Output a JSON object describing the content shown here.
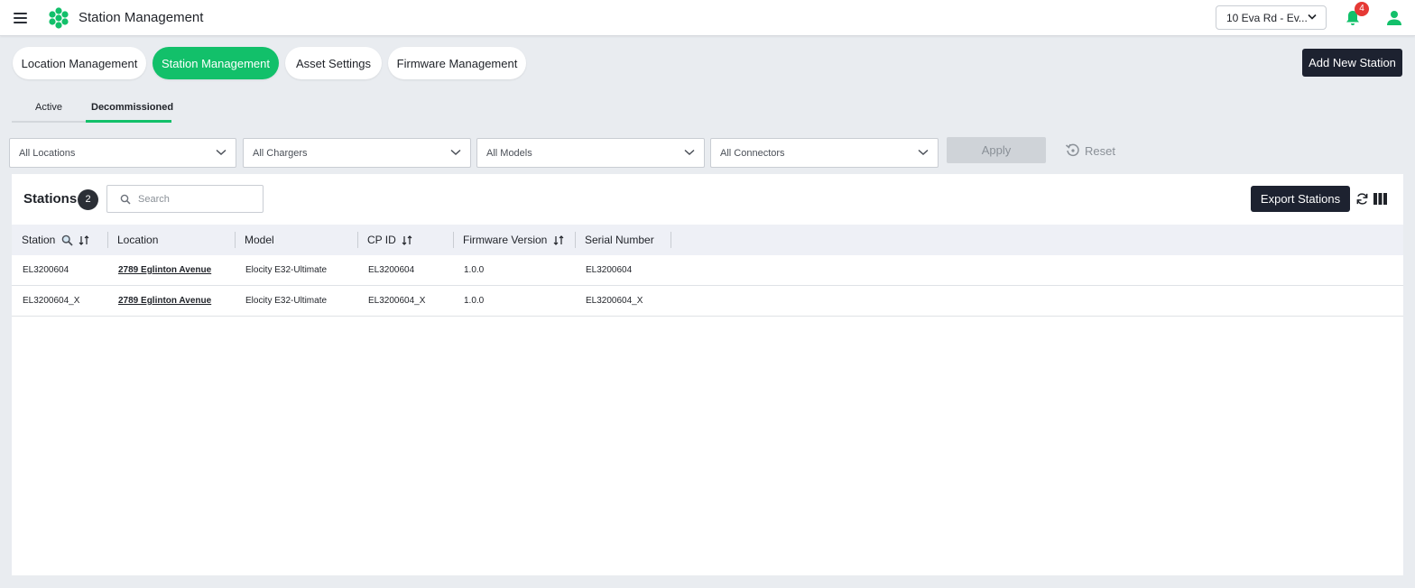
{
  "header": {
    "title": "Station Management",
    "site_selector": "10 Eva Rd - Ev...",
    "notification_count": "4"
  },
  "tabs": [
    {
      "label": "Location Management",
      "active": false
    },
    {
      "label": "Station Management",
      "active": true
    },
    {
      "label": "Asset Settings",
      "active": false
    },
    {
      "label": "Firmware Management",
      "active": false
    }
  ],
  "add_button": "Add New Station",
  "subtabs": [
    {
      "label": "Active",
      "active": false
    },
    {
      "label": "Decommissioned",
      "active": true
    }
  ],
  "filters": {
    "locations": "All Locations",
    "chargers": "All Chargers",
    "models": "All Models",
    "connectors": "All Connectors",
    "apply": "Apply",
    "reset": "Reset"
  },
  "panel": {
    "title": "Stations",
    "count": "2",
    "search_placeholder": "Search",
    "export": "Export Stations"
  },
  "table": {
    "columns": [
      "Station",
      "Location",
      "Model",
      "CP ID",
      "Firmware Version",
      "Serial Number"
    ],
    "rows": [
      {
        "station": "EL3200604",
        "location": "2789 Eglinton Avenue",
        "model": "Elocity E32-Ultimate",
        "cp_id": "EL3200604",
        "firmware": "1.0.0",
        "serial": "EL3200604"
      },
      {
        "station": "EL3200604_X",
        "location": "2789 Eglinton Avenue",
        "model": "Elocity E32-Ultimate",
        "cp_id": "EL3200604_X",
        "firmware": "1.0.0",
        "serial": "EL3200604_X"
      }
    ]
  },
  "colors": {
    "accent": "#12c06a",
    "dark_button": "#1d2230",
    "badge_red": "#e53935"
  }
}
